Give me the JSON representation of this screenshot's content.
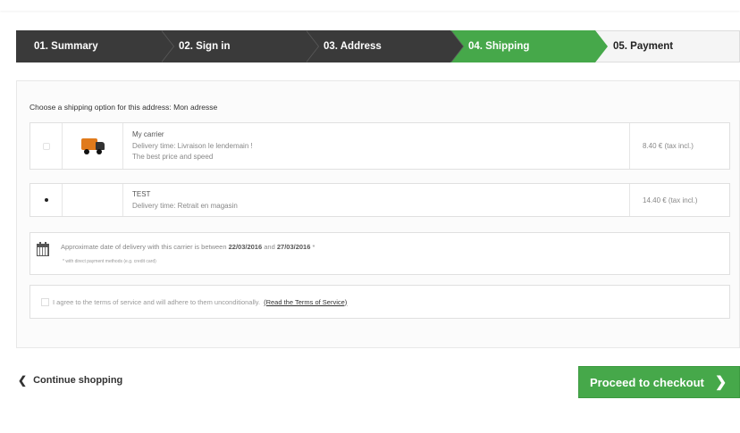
{
  "steps": [
    {
      "label": "01. Summary"
    },
    {
      "label": "02. Sign in"
    },
    {
      "label": "03. Address"
    },
    {
      "label": "04. Shipping"
    },
    {
      "label": "05. Payment"
    }
  ],
  "shipping": {
    "title": "Choose a shipping option for this address: Mon adresse",
    "carriers": [
      {
        "name": "My carrier",
        "delay": "Delivery time: Livraison le lendemain !",
        "extra": "The best price and speed",
        "price": "8.40 € (tax incl.)",
        "selected": false,
        "icon": "truck-icon"
      },
      {
        "name": "TEST",
        "delay": "Delivery time: Retrait en magasin",
        "extra": "",
        "price": "14.40 € (tax incl.)",
        "selected": true,
        "icon": ""
      }
    ],
    "delivery_text_prefix": "Approximate date of delivery with this carrier is between",
    "delivery_from": "22/03/2016",
    "delivery_and": "and",
    "delivery_to": "27/03/2016",
    "delivery_suffix": "*",
    "delivery_note": "* with direct payment methods (e.g. credit card)",
    "terms_text": "I agree to the terms of service and will adhere to them unconditionally.",
    "terms_link": "(Read the Terms of Service)"
  },
  "actions": {
    "continue_label": "Continue shopping",
    "checkout_label": "Proceed to checkout"
  },
  "colors": {
    "accent_green": "#46a84a",
    "step_dark": "#3a3a3a",
    "step_light": "#f5f5f5"
  }
}
